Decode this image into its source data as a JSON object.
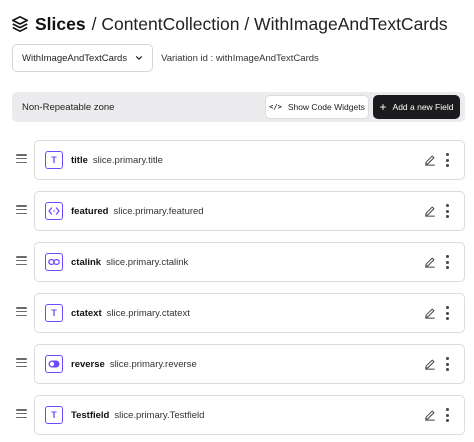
{
  "header": {
    "title": "Slices",
    "breadcrumb": "/ ContentCollection / WithImageAndTextCards"
  },
  "variation": {
    "selected": "WithImageAndTextCards",
    "id_text": "Variation id : withImageAndTextCards"
  },
  "zone": {
    "label": "Non-Repeatable zone",
    "show_widgets_label": "Show Code Widgets",
    "add_field_label": "Add a new Field"
  },
  "fields": [
    {
      "name": "title",
      "path": "slice.primary.title",
      "icon": "text-type-icon",
      "glyph": "T"
    },
    {
      "name": "featured",
      "path": "slice.primary.featured",
      "icon": "embed-type-icon",
      "glyph": "<·>"
    },
    {
      "name": "ctalink",
      "path": "slice.primary.ctalink",
      "icon": "link-type-icon",
      "glyph": "⊂⊃"
    },
    {
      "name": "ctatext",
      "path": "slice.primary.ctatext",
      "icon": "text-type-icon",
      "glyph": "T"
    },
    {
      "name": "reverse",
      "path": "slice.primary.reverse",
      "icon": "boolean-type-icon",
      "glyph": ""
    },
    {
      "name": "Testfield",
      "path": "slice.primary.Testfield",
      "icon": "text-type-icon",
      "glyph": "T"
    }
  ],
  "colors": {
    "accent": "#6d4aff",
    "primary_button": "#1b1b1d",
    "zone_background": "#ececee"
  }
}
